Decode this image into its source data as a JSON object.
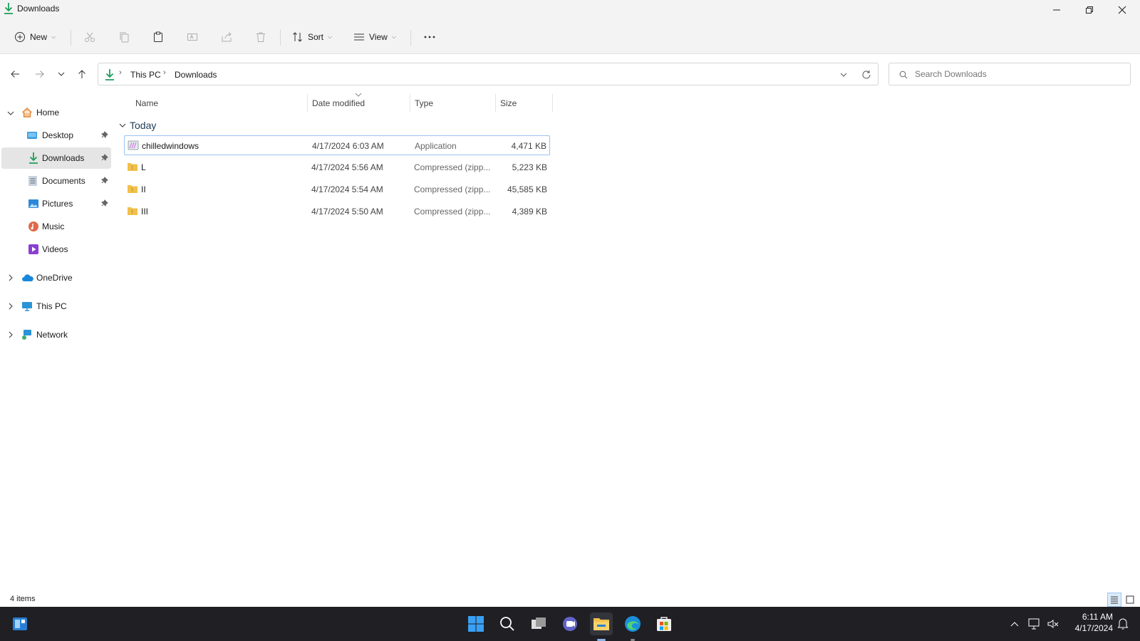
{
  "window": {
    "title": "Downloads"
  },
  "toolbar": {
    "new_label": "New",
    "sort_label": "Sort",
    "view_label": "View"
  },
  "address": {
    "crumbs": [
      "This PC",
      "Downloads"
    ],
    "search_placeholder": "Search Downloads"
  },
  "sidebar": {
    "home": "Home",
    "quick": [
      {
        "label": "Desktop",
        "icon": "desktop-icon",
        "pinned": true
      },
      {
        "label": "Downloads",
        "icon": "download-icon",
        "pinned": true
      },
      {
        "label": "Documents",
        "icon": "documents-icon",
        "pinned": true
      },
      {
        "label": "Pictures",
        "icon": "pictures-icon",
        "pinned": true
      },
      {
        "label": "Music",
        "icon": "music-icon",
        "pinned": false
      },
      {
        "label": "Videos",
        "icon": "videos-icon",
        "pinned": false
      }
    ],
    "roots": [
      "OneDrive",
      "This PC",
      "Network"
    ]
  },
  "columns": {
    "name": "Name",
    "date": "Date modified",
    "type": "Type",
    "size": "Size"
  },
  "group": {
    "label": "Today"
  },
  "files": [
    {
      "name": "chilledwindows",
      "date": "4/17/2024 6:03 AM",
      "type": "Application",
      "size": "4,471 KB",
      "icon": "application-icon"
    },
    {
      "name": "L",
      "date": "4/17/2024 5:56 AM",
      "type": "Compressed (zipp...",
      "size": "5,223 KB",
      "icon": "zip-folder-icon"
    },
    {
      "name": "II",
      "date": "4/17/2024 5:54 AM",
      "type": "Compressed (zipp...",
      "size": "45,585 KB",
      "icon": "zip-folder-icon"
    },
    {
      "name": "III",
      "date": "4/17/2024 5:50 AM",
      "type": "Compressed (zipp...",
      "size": "4,389 KB",
      "icon": "zip-folder-icon"
    }
  ],
  "status": {
    "count": "4 items"
  },
  "clock": {
    "time": "6:11 AM",
    "date": "4/17/2024"
  },
  "colors": {
    "accent": "#0067c0",
    "taskbar": "#1f1f24",
    "folder": "#f1c04b"
  }
}
